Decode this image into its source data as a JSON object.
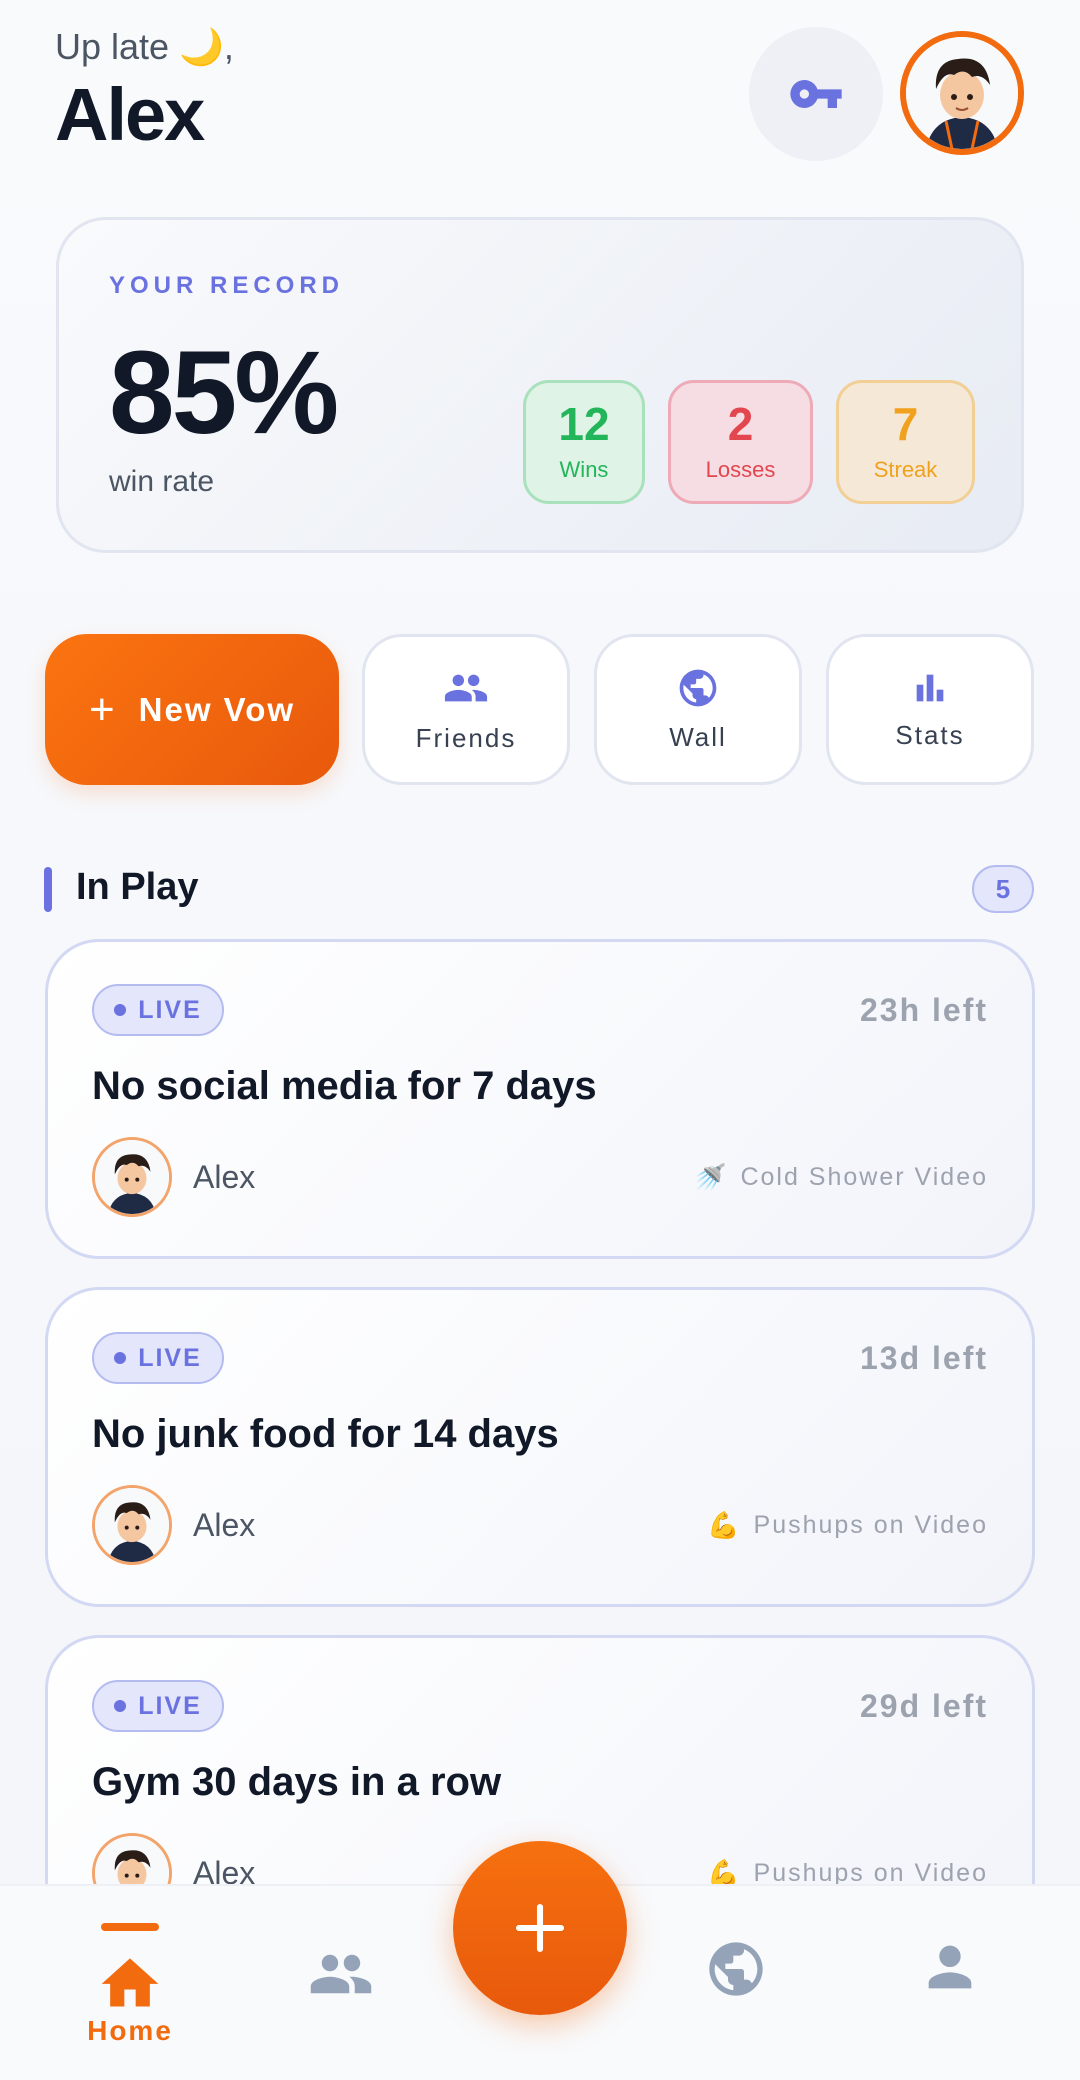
{
  "header": {
    "greeting": "Up late 🌙,",
    "username": "Alex"
  },
  "record": {
    "label": "YOUR RECORD",
    "win_rate": "85%",
    "win_rate_label": "win rate",
    "wins": "12",
    "wins_label": "Wins",
    "losses": "2",
    "losses_label": "Losses",
    "streak": "7",
    "streak_label": "Streak"
  },
  "actions": {
    "new_vow_plus": "+",
    "new_vow_label": "New Vow",
    "friends_label": "Friends",
    "wall_label": "Wall",
    "stats_label": "Stats"
  },
  "section": {
    "title": "In Play",
    "count": "5"
  },
  "vows": [
    {
      "status": "LIVE",
      "time_left": "23h left",
      "title": "No social media for 7 days",
      "owner": "Alex",
      "penalty_emoji": "🚿",
      "penalty": "Cold Shower Video"
    },
    {
      "status": "LIVE",
      "time_left": "13d left",
      "title": "No junk food for 14 days",
      "owner": "Alex",
      "penalty_emoji": "💪",
      "penalty": "Pushups on Video"
    },
    {
      "status": "LIVE",
      "time_left": "29d left",
      "title": "Gym 30 days in a row",
      "owner": "Alex",
      "penalty_emoji": "💪",
      "penalty": "Pushups on Video"
    }
  ],
  "nav": {
    "home_label": "Home"
  },
  "colors": {
    "accent": "#f26b0f",
    "primary": "#6a72e0",
    "wins": "#22b55a",
    "losses": "#e2464f",
    "streak": "#f0a21f",
    "inactive_icon": "#94a3b8"
  },
  "icons": [
    "key-icon",
    "friends-icon",
    "globe-icon",
    "bar-chart-icon",
    "home-icon",
    "people-icon",
    "profile-icon",
    "plus-icon"
  ]
}
